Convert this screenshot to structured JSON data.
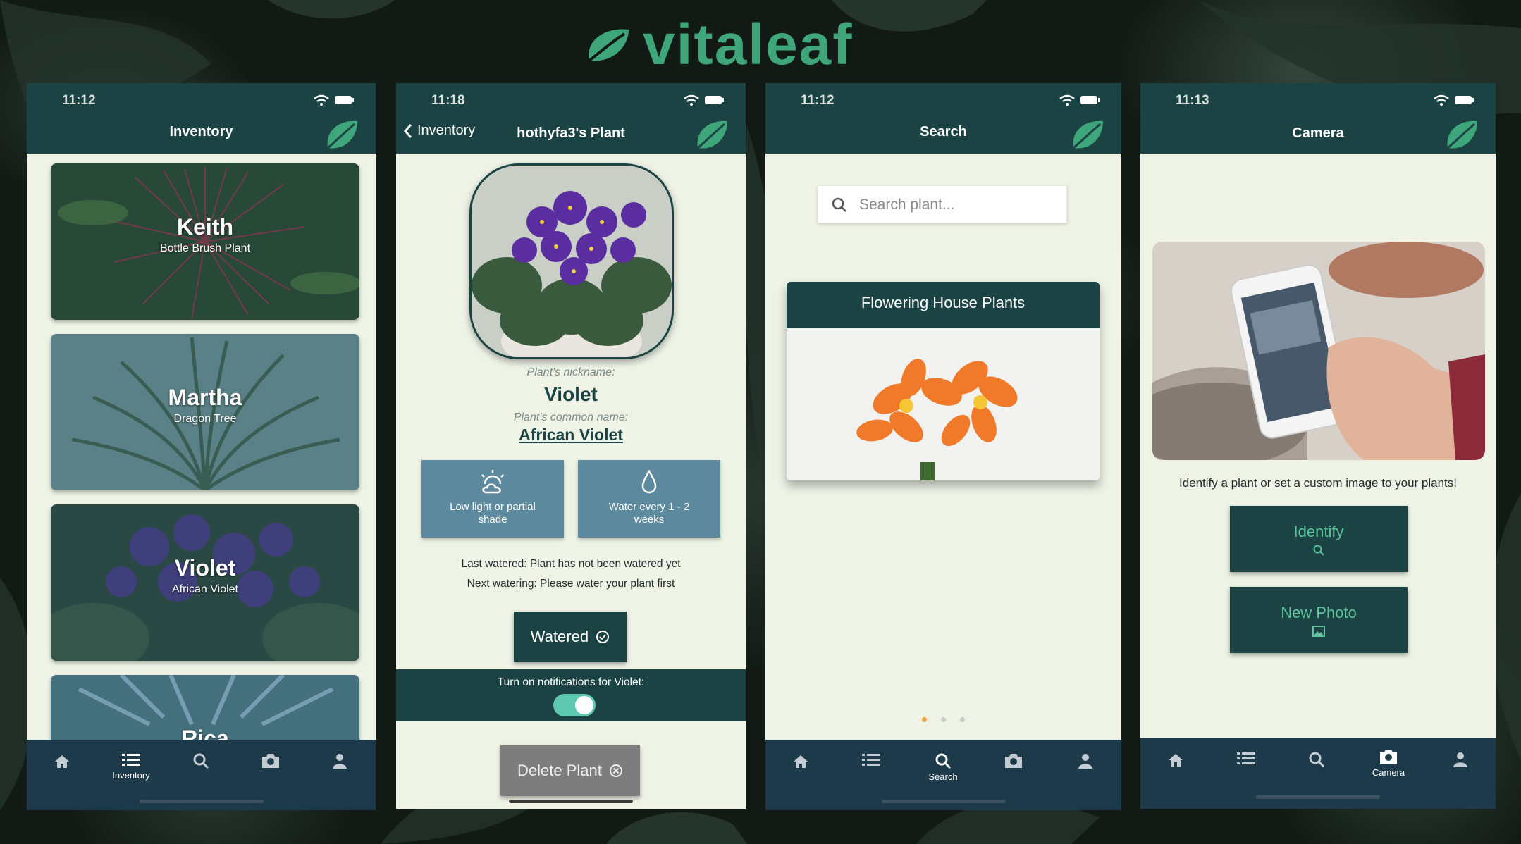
{
  "brand": {
    "name": "vitaleaf",
    "color": "#3fa57a"
  },
  "colors": {
    "primary": "#1b4343",
    "tabbar": "#1d3a4a",
    "background": "#eef3e6",
    "info": "#5d8a9e",
    "toggle": "#5ec9b0",
    "accent": "#f0a33c"
  },
  "screens": {
    "inventory": {
      "time": "11:12",
      "title": "Inventory",
      "plants": [
        {
          "name": "Keith",
          "type": "Bottle Brush Plant"
        },
        {
          "name": "Martha",
          "type": "Dragon Tree"
        },
        {
          "name": "Violet",
          "type": "African Violet"
        },
        {
          "name": "Rica",
          "type": ""
        }
      ],
      "active_tab_label": "Inventory"
    },
    "plant_detail": {
      "time": "11:18",
      "back_label": "Inventory",
      "title": "hothyfa3's Plant",
      "nickname_label": "Plant's nickname:",
      "nickname": "Violet",
      "common_label": "Plant's common name:",
      "common_name": "African Violet",
      "light": {
        "icon": "sun-cloud-icon",
        "text": "Low light or partial shade"
      },
      "water": {
        "icon": "water-drop-icon",
        "text": "Water every 1 - 2 weeks"
      },
      "last_watered": "Last watered: Plant has not been watered yet",
      "next_watering": "Next watering: Please water your plant first",
      "watered_button": "Watered",
      "notifications_text": "Turn on notifications for Violet:",
      "notifications_on": true,
      "delete_button": "Delete Plant"
    },
    "search": {
      "time": "11:12",
      "title": "Search",
      "placeholder": "Search plant...",
      "category": "Flowering House Plants",
      "page_count": 3,
      "current_page": 1,
      "active_tab_label": "Search"
    },
    "camera": {
      "time": "11:13",
      "title": "Camera",
      "caption": "Identify a plant or set a custom image to your plants!",
      "identify_button": "Identify",
      "new_photo_button": "New Photo",
      "active_tab_label": "Camera"
    }
  }
}
